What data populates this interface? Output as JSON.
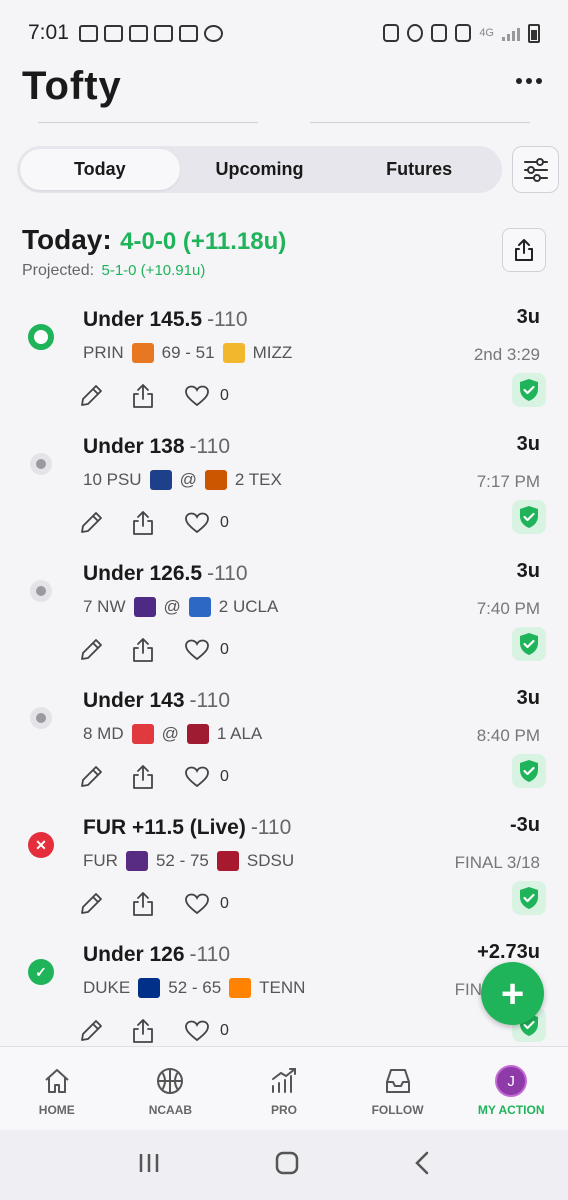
{
  "status_bar": {
    "time": "7:01",
    "network": "4G"
  },
  "header": {
    "title": "Tofty"
  },
  "tabs": [
    {
      "label": "Today",
      "active": true
    },
    {
      "label": "Upcoming",
      "active": false
    },
    {
      "label": "Futures",
      "active": false
    }
  ],
  "summary": {
    "label": "Today:",
    "record": "4-0-0 (+11.18u)",
    "projected_label": "Projected:",
    "projected_value": "5-1-0 (+10.91u)"
  },
  "picks": [
    {
      "selection": "Under 145.5",
      "odds": "-110",
      "units": "3u",
      "team_a": "PRIN",
      "separator": "69 - 51",
      "team_b": "MIZZ",
      "time": "2nd 3:29",
      "likes": "0",
      "status": "live"
    },
    {
      "selection": "Under 138",
      "odds": "-110",
      "units": "3u",
      "team_a": "10 PSU",
      "separator": "@",
      "team_b": "2 TEX",
      "time": "7:17 PM",
      "likes": "0",
      "status": "pending"
    },
    {
      "selection": "Under 126.5",
      "odds": "-110",
      "units": "3u",
      "team_a": "7 NW",
      "separator": "@",
      "team_b": "2 UCLA",
      "time": "7:40 PM",
      "likes": "0",
      "status": "pending"
    },
    {
      "selection": "Under 143",
      "odds": "-110",
      "units": "3u",
      "team_a": "8 MD",
      "separator": "@",
      "team_b": "1 ALA",
      "time": "8:40 PM",
      "likes": "0",
      "status": "pending"
    },
    {
      "selection": "FUR +11.5 (Live)",
      "odds": "-110",
      "units": "-3u",
      "team_a": "FUR",
      "separator": "52 - 75",
      "team_b": "SDSU",
      "time": "FINAL 3/18",
      "likes": "0",
      "status": "loss"
    },
    {
      "selection": "Under 126",
      "odds": "-110",
      "units": "+2.73u",
      "team_a": "DUKE",
      "separator": "52 - 65",
      "team_b": "TENN",
      "time": "FINAL 3/18",
      "likes": "0",
      "status": "win"
    }
  ],
  "fab": {
    "label": "+"
  },
  "bottom_nav": [
    {
      "label": "HOME",
      "icon": "home-icon"
    },
    {
      "label": "NCAAB",
      "icon": "basketball-icon"
    },
    {
      "label": "PRO",
      "icon": "trending-chart-icon"
    },
    {
      "label": "FOLLOW",
      "icon": "inbox-icon"
    },
    {
      "label": "MY ACTION",
      "icon": "avatar",
      "avatar_letter": "J",
      "active": true
    }
  ],
  "colors": {
    "accent": "#1fb35a",
    "loss": "#e52e3c",
    "avatar": "#8e3aa8"
  }
}
